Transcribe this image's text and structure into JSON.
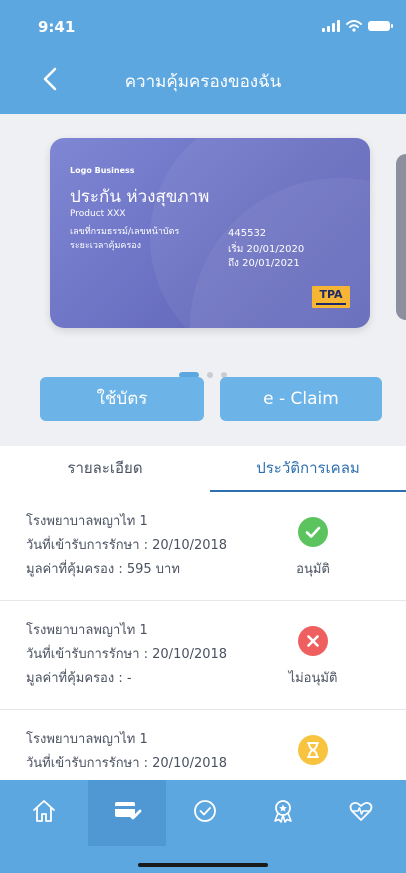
{
  "status_bar": {
    "time": "9:41"
  },
  "header": {
    "title": "ความคุ้มครองของฉัน"
  },
  "card": {
    "logo": "Logo Business",
    "name": "ประกัน ห่วงสุขภาพ",
    "product": "Product XXX",
    "policy_label": "เลขที่กรมธรรม์/เลขหน้าบัตร",
    "policy_number": "445532",
    "period_label": "ระยะเวลาคุ้มครอง",
    "period_start": "เริ่ม 20/01/2020",
    "period_end": "ถึง 20/01/2021",
    "badge": "TPA"
  },
  "carousel": {
    "page_count": 3,
    "active_page": 1
  },
  "actions": {
    "use_card": "ใช้บัตร",
    "e_claim": "e - Claim"
  },
  "tabs": [
    {
      "label": "รายละเอียด",
      "active": false
    },
    {
      "label": "ประวัติการเคลม",
      "active": true
    }
  ],
  "claims": [
    {
      "hospital": "โรงพยาบาลพญาไท 1",
      "admission": "วันที่เข้ารับการรักษา : 20/10/2018",
      "coverage": "มูลค่าที่คุ้มครอง : 595 บาท",
      "status": "อนุมัติ",
      "status_icon": "check-icon"
    },
    {
      "hospital": "โรงพยาบาลพญาไท 1",
      "admission": "วันที่เข้ารับการรักษา : 20/10/2018",
      "coverage": "มูลค่าที่คุ้มครอง : -",
      "status": "ไม่อนุมัติ",
      "status_icon": "cross-icon"
    },
    {
      "hospital": "โรงพยาบาลพญาไท 1",
      "admission": "วันที่เข้ารับการรักษา : 20/10/2018",
      "status_icon": "hourglass-icon"
    }
  ],
  "bottom_nav": [
    {
      "icon": "home-icon",
      "active": false
    },
    {
      "icon": "card-check-icon",
      "active": true
    },
    {
      "icon": "circle-check-icon",
      "active": false
    },
    {
      "icon": "award-icon",
      "active": false
    },
    {
      "icon": "heart-pulse-icon",
      "active": false
    }
  ],
  "colors": {
    "primary": "#5da7e0",
    "button": "#6cb4e8",
    "approved": "#5cc45f",
    "rejected": "#ef5f5f",
    "pending": "#f8c440",
    "active_tab": "#2e6fb0"
  }
}
